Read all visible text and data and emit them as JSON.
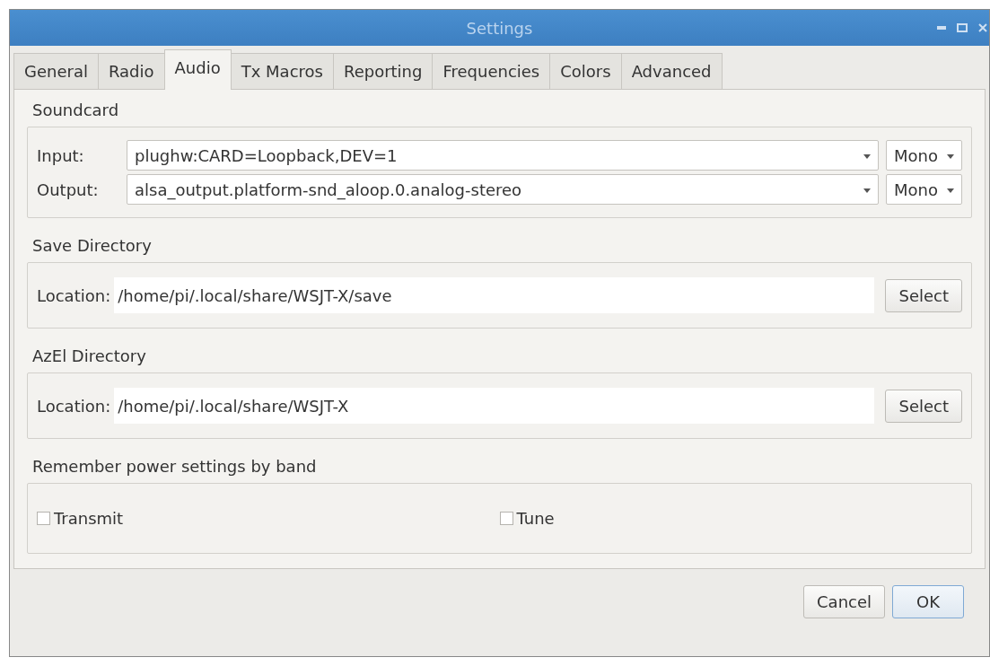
{
  "window": {
    "title": "Settings"
  },
  "tabs": [
    {
      "label": "General",
      "selected": false
    },
    {
      "label": "Radio",
      "selected": false
    },
    {
      "label": "Audio",
      "selected": true
    },
    {
      "label": "Tx Macros",
      "selected": false
    },
    {
      "label": "Reporting",
      "selected": false
    },
    {
      "label": "Frequencies",
      "selected": false
    },
    {
      "label": "Colors",
      "selected": false
    },
    {
      "label": "Advanced",
      "selected": false
    }
  ],
  "soundcard": {
    "title": "Soundcard",
    "rows": [
      {
        "label": "Input:",
        "device": "plughw:CARD=Loopback,DEV=1",
        "channels": "Mono"
      },
      {
        "label": "Output:",
        "device": "alsa_output.platform-snd_aloop.0.analog-stereo",
        "channels": "Mono"
      }
    ]
  },
  "directories": [
    {
      "title": "Save Directory",
      "label": "Location:",
      "value": "/home/pi/.local/share/WSJT-X/save",
      "button": "Select"
    },
    {
      "title": "AzEl Directory",
      "label": "Location:",
      "value": "/home/pi/.local/share/WSJT-X",
      "button": "Select"
    }
  ],
  "power": {
    "title": "Remember power settings by band",
    "options": [
      {
        "label": "Transmit",
        "checked": false
      },
      {
        "label": "Tune",
        "checked": false
      }
    ]
  },
  "buttons": [
    {
      "label": "Cancel",
      "default": false
    },
    {
      "label": "OK",
      "default": true
    }
  ]
}
